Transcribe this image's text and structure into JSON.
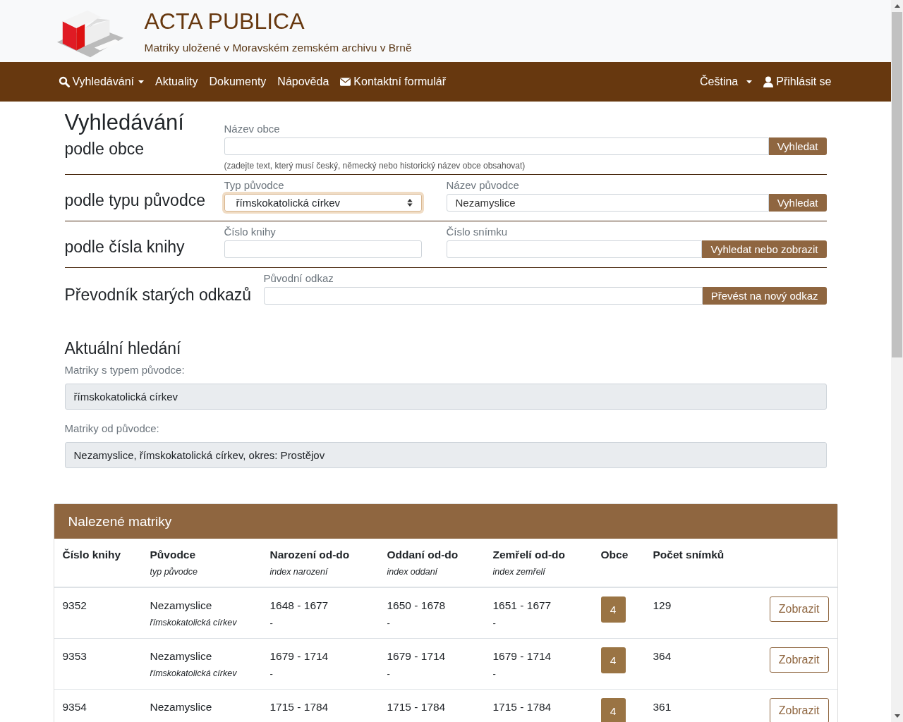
{
  "header": {
    "title": "ACTA PUBLICA",
    "subtitle": "Matriky uložené v Moravském zemském archivu v Brně"
  },
  "nav": {
    "left": [
      {
        "label": "Vyhledávání",
        "kind": "search",
        "dropdown": true
      },
      {
        "label": "Aktuality",
        "kind": "plain",
        "dropdown": false
      },
      {
        "label": "Dokumenty",
        "kind": "plain",
        "dropdown": false
      },
      {
        "label": "Nápověda",
        "kind": "plain",
        "dropdown": false
      },
      {
        "label": "Kontaktní formulář",
        "kind": "contact",
        "dropdown": false
      }
    ],
    "right": [
      {
        "label": "Čeština",
        "kind": "plain",
        "dropdown": true
      },
      {
        "label": "Přihlásit se",
        "kind": "login",
        "dropdown": false
      }
    ]
  },
  "search": {
    "heading": "Vyhledávání",
    "by_municipality": {
      "title": "podle obce",
      "label": "Název obce",
      "button": "Vyhledat",
      "hint": "(zadejte text, který musí český, německý nebo historický název obce obsahovat)"
    },
    "by_type": {
      "title": "podle typu původce",
      "type_label": "Typ původce",
      "type_value": "římskokatolická církev",
      "focused": true,
      "name_label": "Název původce",
      "name_value": "Nezamyslice",
      "button": "Vyhledat"
    },
    "by_book": {
      "title": "podle čísla knihy",
      "book_label": "Číslo knihy",
      "image_label": "Číslo snímku",
      "button": "Vyhledat nebo zobrazit"
    },
    "converter": {
      "title": "Převodník starých odkazů",
      "label": "Původní odkaz",
      "button": "Převést na nový odkaz"
    }
  },
  "current_search": {
    "title": "Aktuální hledání",
    "items": [
      {
        "label": "Matriky s typem původce:",
        "value": "římskokatolická církev"
      },
      {
        "label": "Matriky od původce:",
        "value": "Nezamyslice, římskokatolická církev, okres: Prostějov"
      }
    ]
  },
  "results": {
    "title": "Nalezené matriky",
    "columns": [
      {
        "label": "Číslo knihy"
      },
      {
        "label": "Původce",
        "sublabel": "typ původce"
      },
      {
        "label": "Narození od-do",
        "sublabel": "index narození"
      },
      {
        "label": "Oddaní od-do",
        "sublabel": "index oddaní"
      },
      {
        "label": "Zemřelí od-do",
        "sublabel": "index zemřelí"
      },
      {
        "label": "Obce"
      },
      {
        "label": "Počet snímků"
      }
    ],
    "rows": [
      {
        "book": "9352",
        "originator": "Nezamyslice",
        "originator_type": "římskokatolická církev",
        "births": "1648 - 1677",
        "births_index": "-",
        "marriages": "1650 - 1678",
        "marriages_index": "-",
        "deaths": "1651 - 1677",
        "deaths_index": "-",
        "municipalities": "4",
        "images": "129",
        "button": "Zobrazit"
      },
      {
        "book": "9353",
        "originator": "Nezamyslice",
        "originator_type": "římskokatolická církev",
        "births": "1679 - 1714",
        "births_index": "-",
        "marriages": "1679 - 1714",
        "marriages_index": "-",
        "deaths": "1679 - 1714",
        "deaths_index": "-",
        "municipalities": "4",
        "images": "364",
        "button": "Zobrazit"
      },
      {
        "book": "9354",
        "originator": "Nezamyslice",
        "births": "1715 - 1784",
        "marriages": "1715 - 1784",
        "deaths": "1715 - 1784",
        "municipalities": "4",
        "images": "361",
        "button": "Zobrazit"
      }
    ]
  }
}
